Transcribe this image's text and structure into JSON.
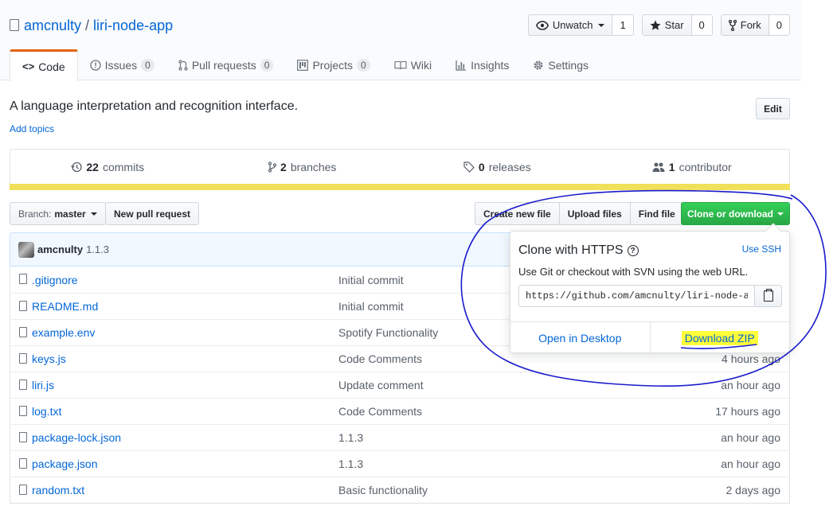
{
  "repo": {
    "owner": "amcnulty",
    "separator": "/",
    "name": "liri-node-app"
  },
  "actions": [
    {
      "label": "Unwatch",
      "icon": "eye-icon",
      "count": "1",
      "dropdown": true
    },
    {
      "label": "Star",
      "icon": "star-icon",
      "count": "0"
    },
    {
      "label": "Fork",
      "icon": "fork-icon",
      "count": "0"
    }
  ],
  "nav": [
    {
      "label": "Code",
      "icon": "code-icon",
      "selected": true
    },
    {
      "label": "Issues",
      "icon": "issue-icon",
      "count": "0"
    },
    {
      "label": "Pull requests",
      "icon": "pull-request-icon",
      "count": "0"
    },
    {
      "label": "Projects",
      "icon": "project-icon",
      "count": "0"
    },
    {
      "label": "Wiki",
      "icon": "book-icon"
    },
    {
      "label": "Insights",
      "icon": "graph-icon"
    },
    {
      "label": "Settings",
      "icon": "gear-icon"
    }
  ],
  "description": "A language interpretation and recognition interface.",
  "add_topics": "Add topics",
  "edit_label": "Edit",
  "summary": {
    "commits": {
      "num": "22",
      "label": "commits"
    },
    "branches": {
      "num": "2",
      "label": "branches"
    },
    "releases": {
      "num": "0",
      "label": "releases"
    },
    "contributors": {
      "num": "1",
      "label": "contributor"
    }
  },
  "language_color": "#f1e05a",
  "branch": {
    "label": "Branch:",
    "value": "master"
  },
  "new_pr_label": "New pull request",
  "file_buttons": {
    "create": "Create new file",
    "upload": "Upload files",
    "find": "Find file"
  },
  "clone_button": "Clone or download",
  "latest_commit": {
    "author": "amcnulty",
    "message": "1.1.3"
  },
  "files": [
    {
      "name": ".gitignore",
      "commit": "Initial commit",
      "age": ""
    },
    {
      "name": "README.md",
      "commit": "Initial commit",
      "age": ""
    },
    {
      "name": "example.env",
      "commit": "Spotify Functionality",
      "age": ""
    },
    {
      "name": "keys.js",
      "commit": "Code Comments",
      "age": "4 hours ago"
    },
    {
      "name": "liri.js",
      "commit": "Update comment",
      "age": "an hour ago"
    },
    {
      "name": "log.txt",
      "commit": "Code Comments",
      "age": "17 hours ago"
    },
    {
      "name": "package-lock.json",
      "commit": "1.1.3",
      "age": "an hour ago"
    },
    {
      "name": "package.json",
      "commit": "1.1.3",
      "age": "an hour ago"
    },
    {
      "name": "random.txt",
      "commit": "Basic functionality",
      "age": "2 days ago"
    }
  ],
  "clone_popup": {
    "title": "Clone with HTTPS",
    "help": "?",
    "use_ssh": "Use SSH",
    "subtitle": "Use Git or checkout with SVN using the web URL.",
    "url": "https://github.com/amcnulty/liri-node-app.git",
    "open_desktop": "Open in Desktop",
    "download_zip": "Download ZIP"
  },
  "colors": {
    "link": "#0366d6",
    "clone_green": "#28a745",
    "annotation_blue": "#1a1acc",
    "highlight": "#ffff3a",
    "nav_accent": "#e36209"
  }
}
